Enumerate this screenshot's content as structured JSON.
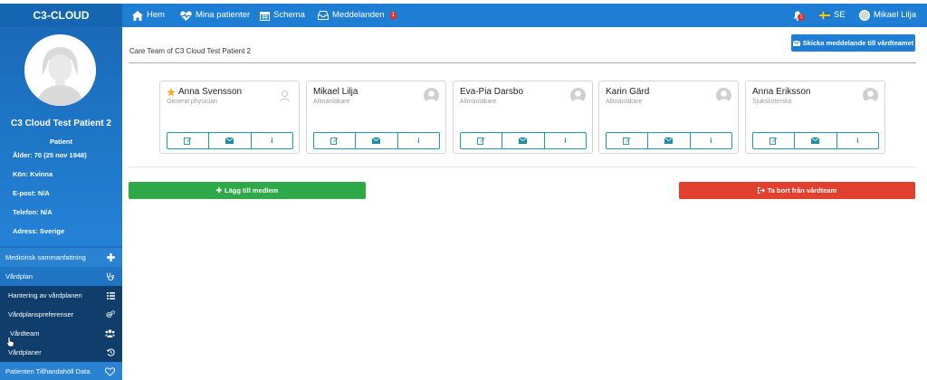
{
  "app": {
    "brand": "C3-CLOUD"
  },
  "nav": {
    "home": "Hem",
    "patients": "Mina patienter",
    "schedule": "Schema",
    "messages": "Meddelanden",
    "messages_badge": "1",
    "bell_badge": "1",
    "language": "SE",
    "user": "Mikael Lilja"
  },
  "patient": {
    "name": "C3 Cloud Test Patient 2",
    "role": "Patient",
    "age": "Ålder: 70 (25 nov 1948)",
    "gender": "Kön: Kvinna",
    "email": "E-post: N/A",
    "phone": "Telefon: N/A",
    "address": "Adress: Sverige"
  },
  "sidebar": {
    "items": [
      {
        "label": "Medicinsk sammanfattning",
        "icon": "plus-icon"
      },
      {
        "label": "Vårdplan",
        "icon": "stethoscope-icon"
      },
      {
        "label": "Hantering av vårdplanen",
        "icon": "list-icon"
      },
      {
        "label": "Vårdplanspreferenser",
        "icon": "cogs-icon"
      },
      {
        "label": "Vårdteam",
        "icon": "users-icon"
      },
      {
        "label": "Vårdplaner",
        "icon": "history-icon"
      },
      {
        "label": "Patienten Tillhandahöll Data",
        "icon": "heart-icon"
      }
    ]
  },
  "main": {
    "title": "Care Team of C3 Cloud Test Patient 2",
    "send_button": "Skicka meddelande till vårdteamet",
    "add_button": "Lägg till medlem",
    "remove_button": "Ta bort från vårdteam"
  },
  "team": [
    {
      "name": "Anna Svensson",
      "role": "General physician",
      "starred": true
    },
    {
      "name": "Mikael Lilja",
      "role": "Allmänläkare",
      "starred": false
    },
    {
      "name": "Eva-Pia Darsbo",
      "role": "Allmänläkare",
      "starred": false
    },
    {
      "name": "Karin Gärd",
      "role": "Allmänläkare",
      "starred": false
    },
    {
      "name": "Anna Eriksson",
      "role": "Sjuksköterska",
      "starred": false
    }
  ],
  "colors": {
    "primary": "#1e7ed4",
    "sidebar": "#1d6fc0",
    "success": "#2fa84a",
    "danger": "#e2402f",
    "teal": "#1d9ab0",
    "star": "#f2b01e"
  }
}
